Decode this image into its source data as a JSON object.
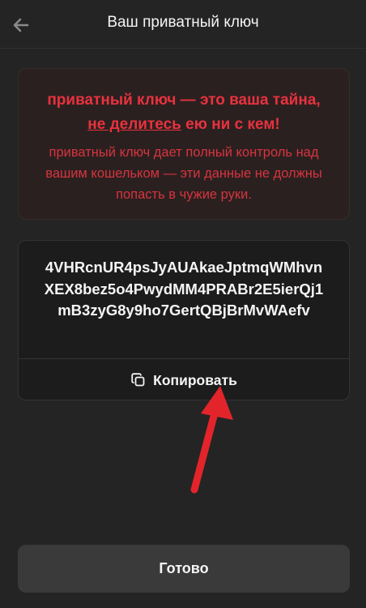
{
  "header": {
    "title": "Ваш приватный ключ",
    "back_icon": "arrow-left-icon"
  },
  "warning": {
    "line1": "приватный ключ — это ваша тайна,",
    "line2_underlined": "не делитесь",
    "line2_rest": " ею ни с кем!",
    "body": "приватный ключ дает полный контроль над вашим кошельком — эти данные не должны попасть в чужие руки.",
    "accent_color": "#e8323e"
  },
  "key": {
    "value": "4VHRcnUR4psJyAUAkaeJptmqWMhvnXEX8bez5o4PwydMM4PRABr2E5ierQj1mB3zyG8y9ho7GertQBjBrMvWAefv",
    "copy_label": "Копировать",
    "copy_icon": "copy-icon"
  },
  "annotation": {
    "arrow_color": "#e3242b"
  },
  "footer": {
    "done_label": "Готово"
  }
}
